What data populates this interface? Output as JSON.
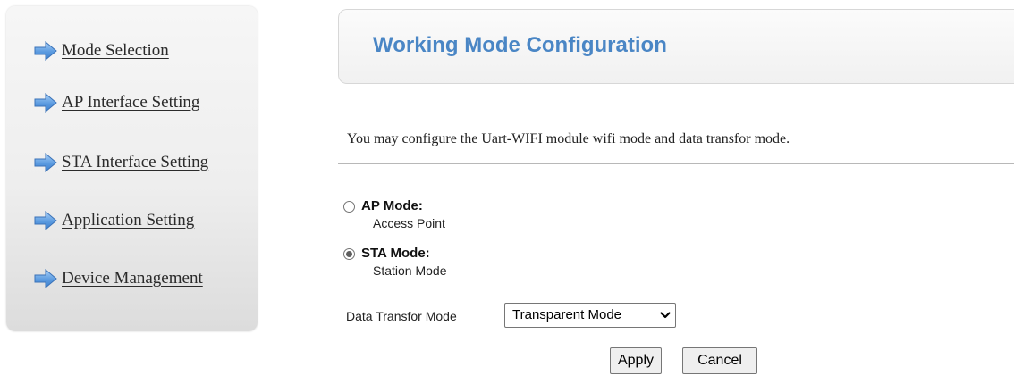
{
  "sidebar": {
    "items": [
      {
        "label": "Mode Selection",
        "icon": "arrow-right-icon"
      },
      {
        "label": "AP Interface Setting",
        "icon": "arrow-right-icon"
      },
      {
        "label": "STA Interface Setting",
        "icon": "arrow-right-icon"
      },
      {
        "label": "Application Setting",
        "icon": "arrow-right-icon"
      },
      {
        "label": "Device Management",
        "icon": "arrow-right-icon"
      }
    ]
  },
  "header": {
    "title": "Working Mode Configuration"
  },
  "description": "You may configure the Uart-WIFI module wifi mode and data transfor mode.",
  "modes": [
    {
      "title": "AP Mode:",
      "subtitle": "Access Point",
      "checked": false
    },
    {
      "title": "STA Mode:",
      "subtitle": "Station Mode",
      "checked": true
    }
  ],
  "data_transfer": {
    "label": "Data Transfor Mode",
    "selected": "Transparent Mode"
  },
  "buttons": {
    "apply": "Apply",
    "cancel": "Cancel"
  },
  "colors": {
    "title_blue": "#4a86c5",
    "arrow_blue": "#5b9be0"
  }
}
